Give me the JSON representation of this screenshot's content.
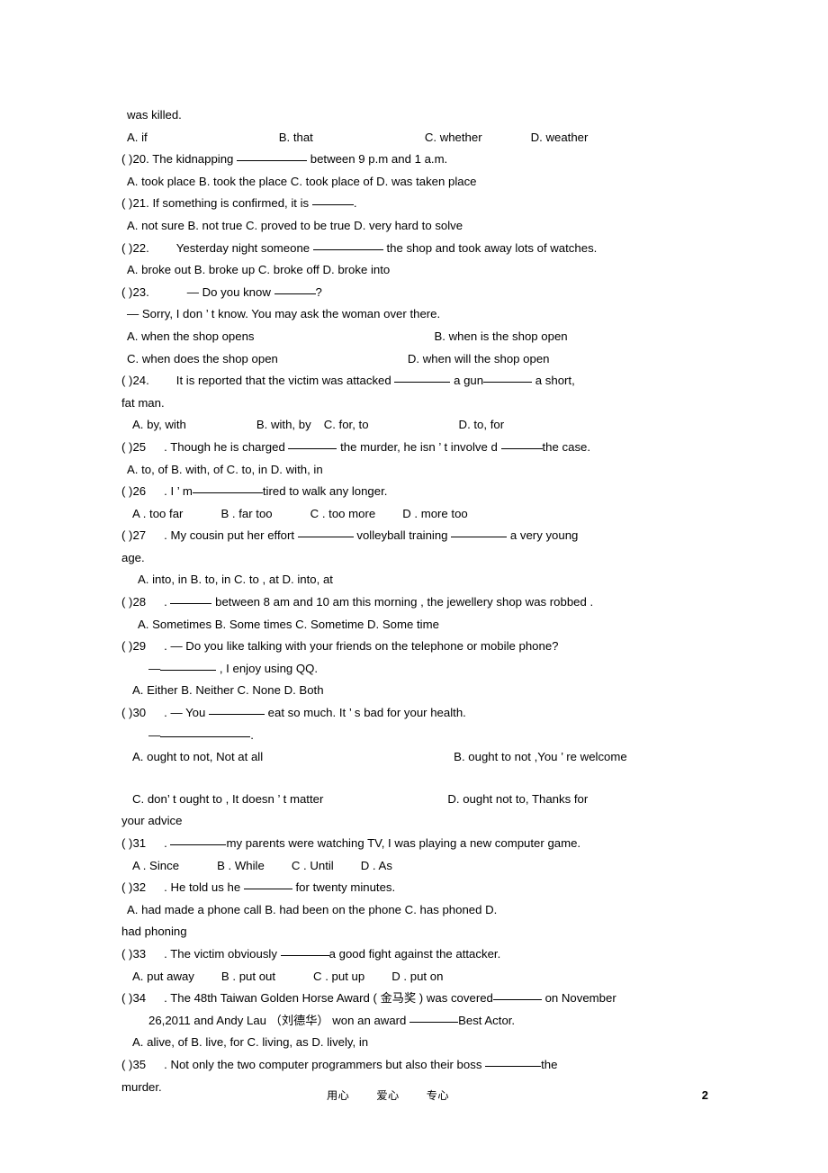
{
  "document": {
    "page_number": "2",
    "footer_words": [
      "用心",
      "爱心",
      "专心"
    ]
  },
  "lines": {
    "l01": "was killed.",
    "q19_opts": {
      "a": "A. if",
      "b": "B. that",
      "c": "C. whether",
      "d": "D. weather"
    },
    "q20": {
      "marker": "(    )20. The kidnapping",
      "tail": "between 9 p.m and 1 a.m.",
      "opts": "A. took place  B. took the place  C. took place of   D. was taken place"
    },
    "q21": {
      "marker": "(    )21. If something is confirmed, it is",
      "tail": ".",
      "opts": "A. not sure   B. not true   C. proved to be true   D. very hard to solve"
    },
    "q22": {
      "marker": "(    )22.",
      "stem_pre": "Yesterday   night   someone",
      "stem_post": "the   shop   and took   away lots   of   watches.",
      "opts": "A. broke out      B. broke up       C. broke off      D. broke into"
    },
    "q23": {
      "marker": "(    )23.",
      "stem": "— Do you know",
      "stem_tail": "?",
      "reply": "—  Sorry, I don      ’  t know. You may ask the woman over there.",
      "opt_a": "A. when the shop opens",
      "opt_b": "B. when is the shop open",
      "opt_c": "C. when does the shop open",
      "opt_d": "D. when will the shop open"
    },
    "q24": {
      "marker": "(    )24.",
      "stem_pre": "It   is   reported    that   the   victim    was attacked",
      "stem_mid": "a gun",
      "stem_post": "a  short,",
      "stem_wrap": "fat man.",
      "opt_a": "A. by, with",
      "opt_b": "B. with, by",
      "opt_c": "C. for, to",
      "opt_d": "D. to, for"
    },
    "q25": {
      "marker": "(    )25",
      "stem_pre": ". Though he is   charged",
      "stem_mid": "the   murder,   he isn ’  t  involve  d",
      "stem_post": "the   case.",
      "opts": "A. to, of          B. with, of        C. to, in          D. with, in"
    },
    "q26": {
      "marker": "(    )26",
      "stem_pre": ". I ’  m",
      "stem_post": "tired to walk any longer.",
      "opt_a": "A  .   too far",
      "opt_b": "B        .  far too",
      "opt_c": "C         .  too more",
      "opt_d": "D        .  more too"
    },
    "q27": {
      "marker": "(    )27",
      "stem_pre": ". My cousin   put  her  effort",
      "stem_mid": "volleyball      training",
      "stem_post": "a very  young",
      "stem_wrap": "age.",
      "opts": "A. into, in      B. to, in           C. to , at       D. into, at"
    },
    "q28": {
      "marker": "(    )28",
      "stem_pre": ".",
      "stem_post": "between 8 am and 10 am this    morning  ,  the   jewellery     shop was robbed  .",
      "opts": "A. Sometimes   B. Some times   C. Sometime    D. Some time"
    },
    "q29": {
      "marker": "(    )29",
      "stem": ". — Do you like   talking    with   your  friends    on the  telephone   or  mobile   phone?",
      "reply_pre": "—",
      "reply_post": ", I enjoy using QQ.",
      "opts": "A. Either    B. Neither        C. None         D. Both"
    },
    "q30": {
      "marker": "(    )30",
      "stem_pre": ". — You",
      "stem_post": "eat so much. It         ’  s bad for your health.",
      "reply_pre": "—",
      "reply_post": ".",
      "opt_a": "A.   ought to not, Not at all",
      "opt_b": "B. ought to not ,You          ’  re welcome",
      "opt_c": "C.  don’  t ought to , It doesn          ’  t matter",
      "opt_d": "D. ought not to, Thanks for",
      "opt_d_wrap": "your advice"
    },
    "q31": {
      "marker": "(    )31",
      "stem_pre": ".",
      "stem_post": "my parents were watching TV, I was playing a new computer game.",
      "opt_a": "A .   Since",
      "opt_b": "B        .  While",
      "opt_c": "C        .  Until",
      "opt_d": "D        .  As"
    },
    "q32": {
      "marker": "(    )32",
      "stem_pre": ". He told us he",
      "stem_post": "for twenty minutes.",
      "opts": "A. had made a phone call   B. had been on the phone    C. has phoned      D.",
      "opts_wrap": "had phoning"
    },
    "q33": {
      "marker": "(    )33",
      "stem_pre": ". The victim obviously",
      "stem_post": "a good fight against the attacker.",
      "opt_a": "A.   put away",
      "opt_b": "B      .  put out",
      "opt_c": "C         .  put up",
      "opt_d": "D        .  put on"
    },
    "q34": {
      "marker": "(    )34",
      "stem_pre": ". The 48th  Taiwan  Golden  Horse   Award ( 金马奖 )  was covered",
      "stem_post": "on November",
      "stem_wrap_pre": "26,2011 and Andy Lau      （刘德华）    won an award",
      "stem_wrap_post": "Best Actor.",
      "opts": "A. alive, of       B. live, for        C. living, as      D. lively, in"
    },
    "q35": {
      "marker": "(    )35",
      "stem_pre": ". Not only the two computer programmers but also their boss",
      "stem_post": "the",
      "stem_wrap": "murder."
    }
  }
}
